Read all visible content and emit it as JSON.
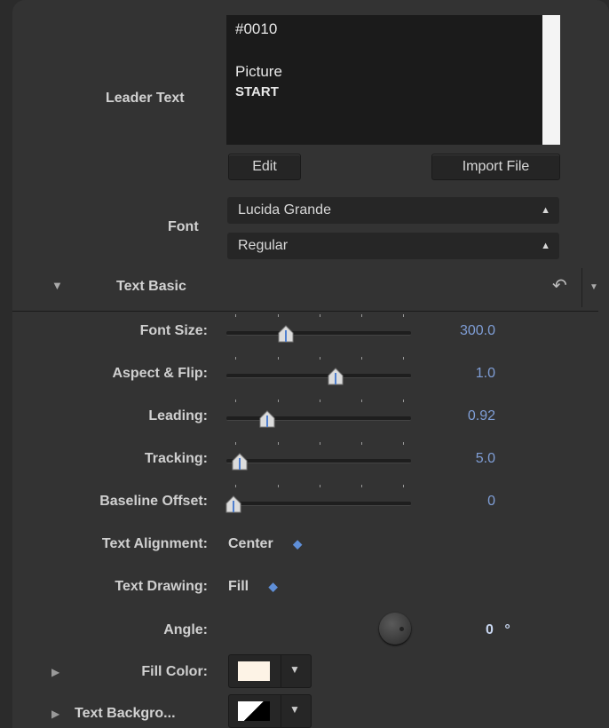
{
  "leader_text": {
    "label": "Leader Text",
    "lines": [
      "#0010",
      "Picture",
      "START"
    ],
    "edit_button": "Edit",
    "import_button": "Import File"
  },
  "font": {
    "label": "Font",
    "family": "Lucida Grande",
    "style": "Regular"
  },
  "section": {
    "title": "Text Basic"
  },
  "params": [
    {
      "label": "Font Size:",
      "value": "300.0",
      "slider_fraction": 0.32
    },
    {
      "label": "Aspect & Flip:",
      "value": "1.0",
      "slider_fraction": 0.59
    },
    {
      "label": "Leading:",
      "value": "0.92",
      "slider_fraction": 0.22
    },
    {
      "label": "Tracking:",
      "value": "5.0",
      "slider_fraction": 0.07
    },
    {
      "label": "Baseline Offset:",
      "value": "0",
      "slider_fraction": 0.04
    }
  ],
  "text_alignment": {
    "label": "Text Alignment:",
    "value": "Center"
  },
  "text_drawing": {
    "label": "Text Drawing:",
    "value": "Fill"
  },
  "angle": {
    "label": "Angle:",
    "value": "0",
    "unit": "°"
  },
  "fill_color": {
    "label": "Fill Color:",
    "color": "#fdf3e6"
  },
  "text_background": {
    "label": "Text Backgro..."
  },
  "colors": {
    "accent": "#7f9ed6",
    "panel": "#333333"
  }
}
